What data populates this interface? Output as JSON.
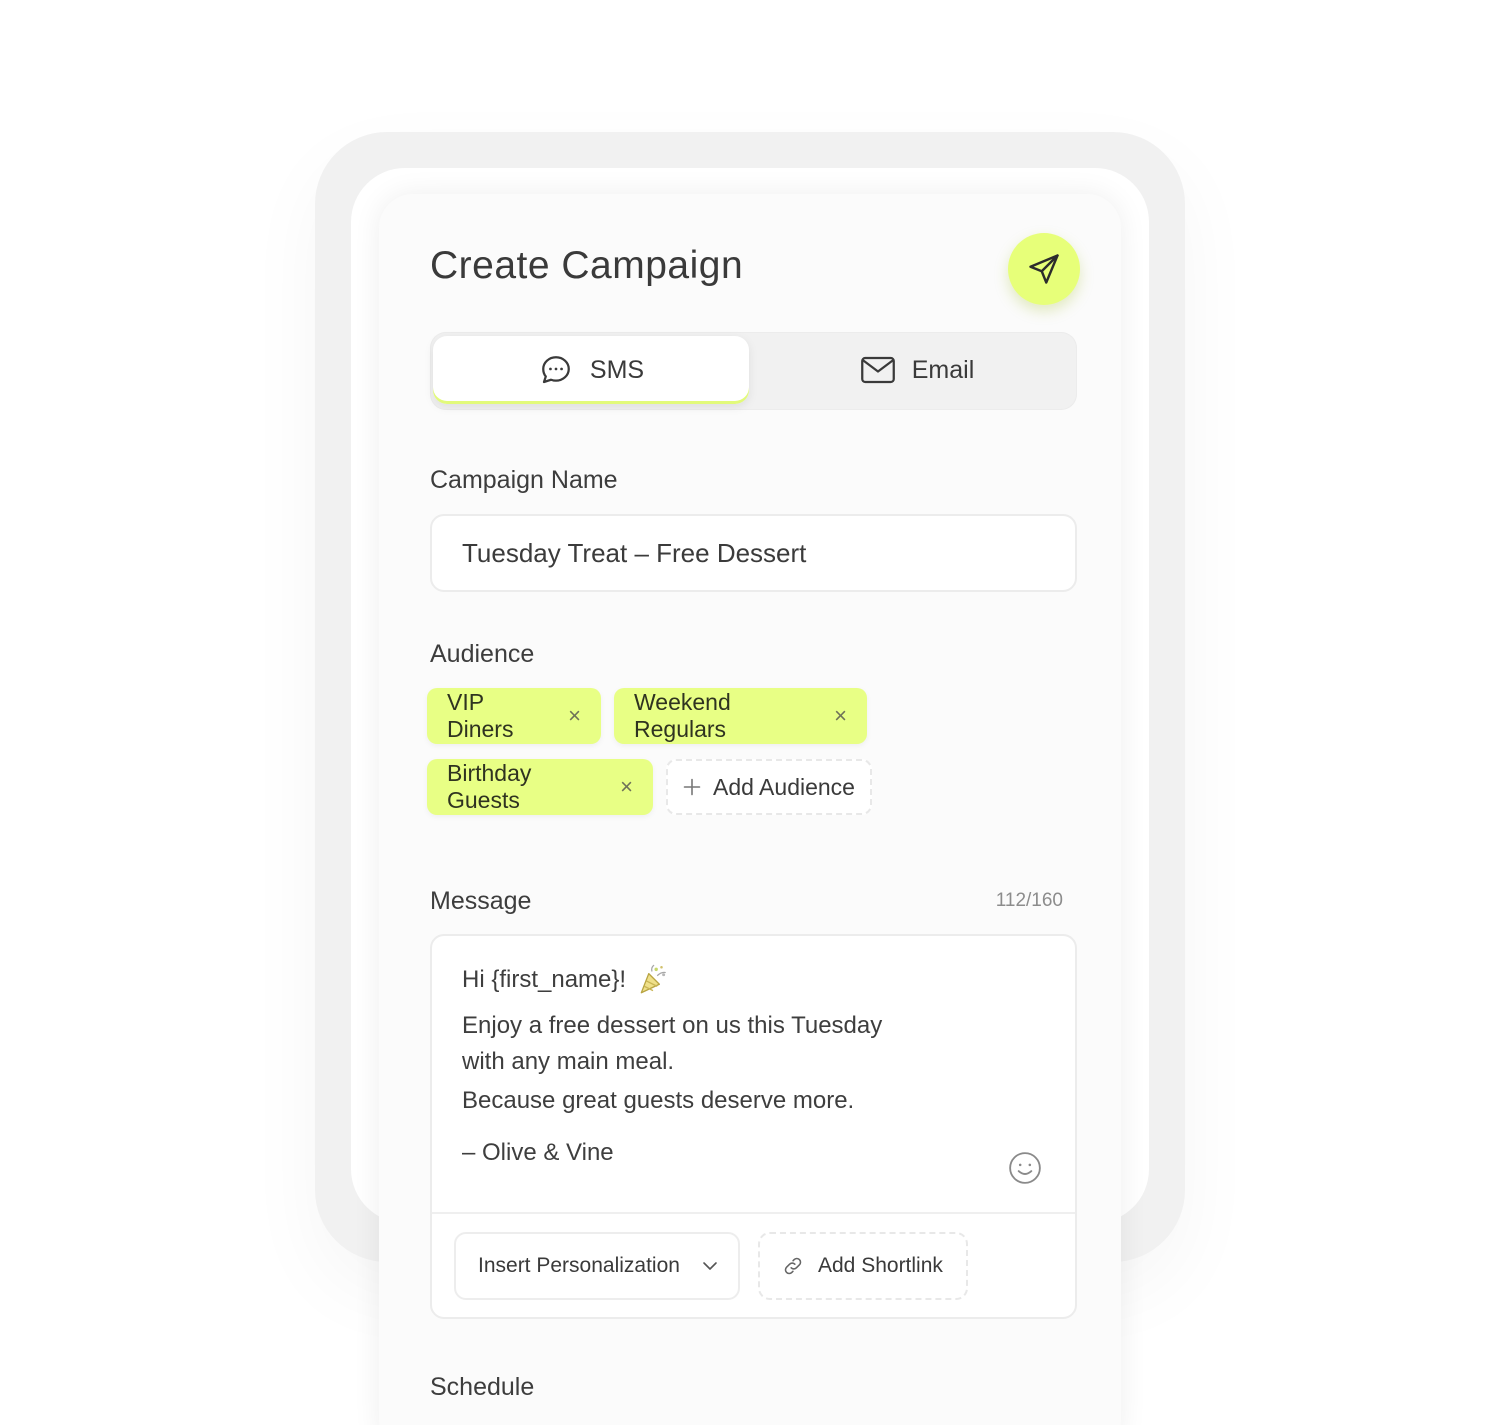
{
  "header": {
    "title": "Create Campaign",
    "send_icon": "paper-plane-icon"
  },
  "tabs": {
    "sms": {
      "label": "SMS",
      "icon": "chat-bubble-icon",
      "selected": true
    },
    "email": {
      "label": "Email",
      "icon": "envelope-icon",
      "selected": false
    }
  },
  "campaign_name": {
    "label": "Campaign Name",
    "value": "Tuesday Treat – Free Dessert"
  },
  "audience": {
    "label": "Audience",
    "chips": [
      {
        "label": "VIP Diners",
        "remove": "×"
      },
      {
        "label": "Weekend Regulars",
        "remove": "×"
      },
      {
        "label": "Birthday Guests",
        "remove": "×"
      }
    ],
    "add_label": "Add Audience",
    "add_icon": "plus-icon"
  },
  "message": {
    "label": "Message",
    "counter": "112/160",
    "lines": [
      "Hi {first_name}!",
      "Enjoy a free dessert on us this Tuesday",
      "with any main meal.",
      "Because great guests deserve more.",
      "– Olive & Vine"
    ],
    "emoji_icon": "party-popper-icon",
    "smiley_icon": "smiley-icon",
    "personalization_label": "Insert Personalization",
    "shortlink_label": "Add Shortlink"
  },
  "schedule": {
    "label": "Schedule"
  },
  "colors": {
    "accent": "#e7ff79",
    "chip_bg": "#e8ff85",
    "card_bg": "#fbfbfb",
    "frame_bg": "#f1f1f1"
  }
}
